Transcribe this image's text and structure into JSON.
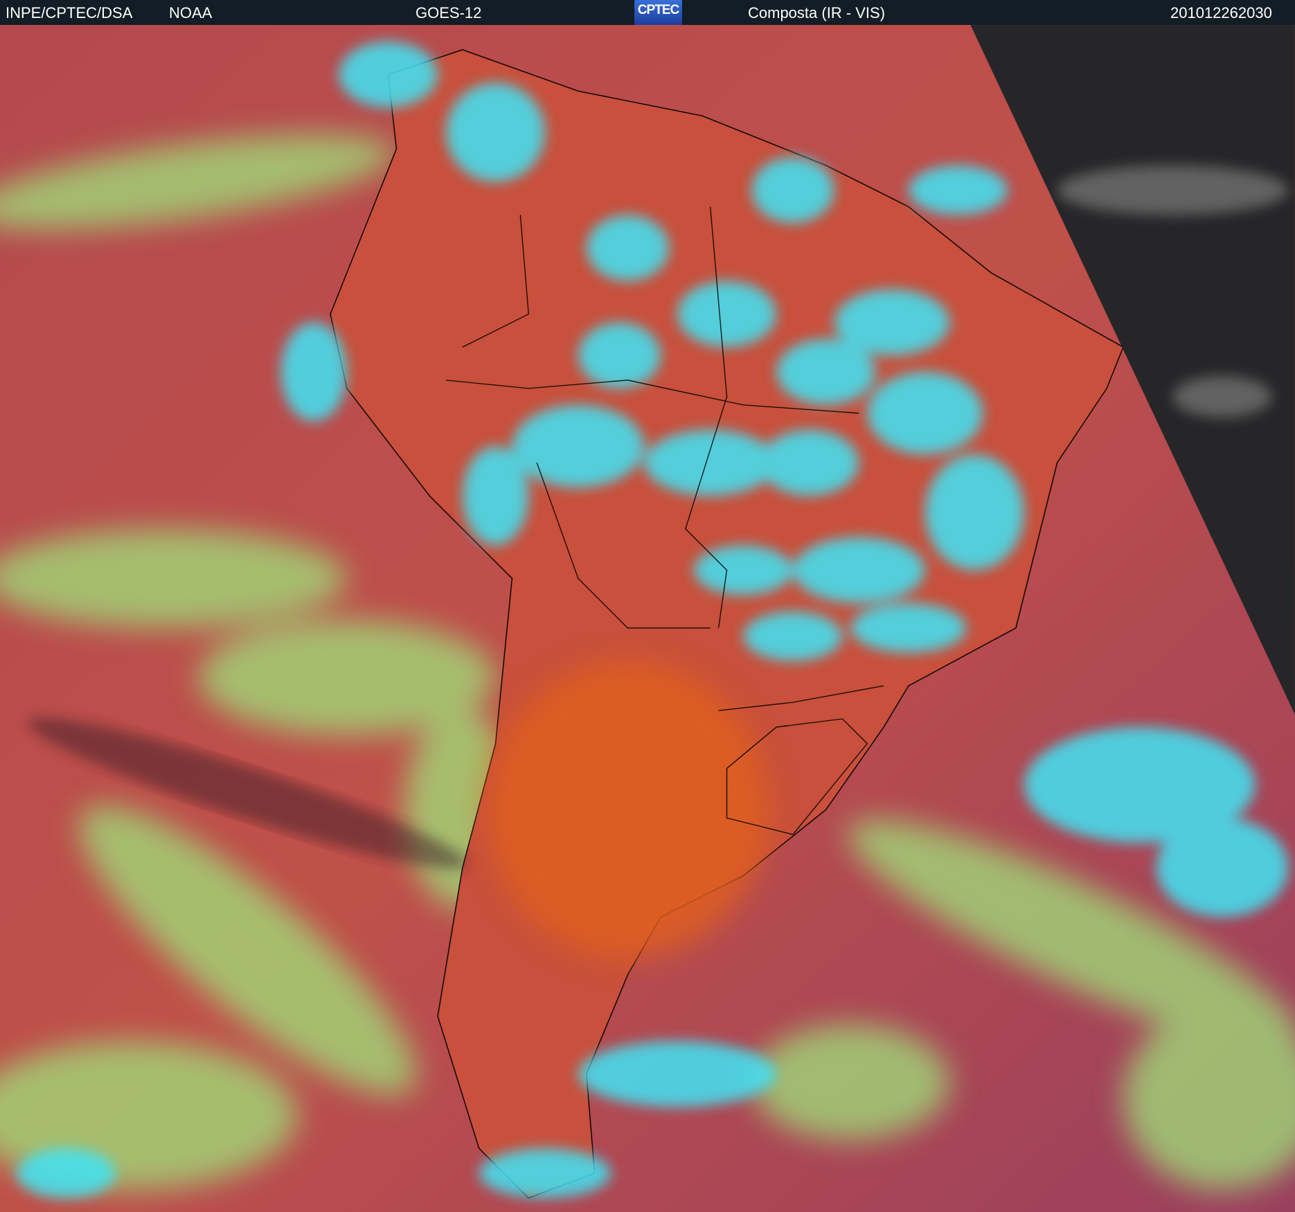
{
  "header": {
    "agency": "INPE/CPTEC/DSA",
    "source": "NOAA",
    "satellite": "GOES-12",
    "logo_text": "CPTEC",
    "product": "Composta (IR - VIS)",
    "timestamp": "201012262030"
  },
  "imagery": {
    "region": "South America",
    "colors": {
      "ocean_clear": "#b0474f",
      "land_clear": "#d85a2a",
      "high_cloud": "#3fe6f5",
      "low_cloud": "#9fe27a",
      "no_data": "#262628",
      "borders": "#000000"
    }
  }
}
